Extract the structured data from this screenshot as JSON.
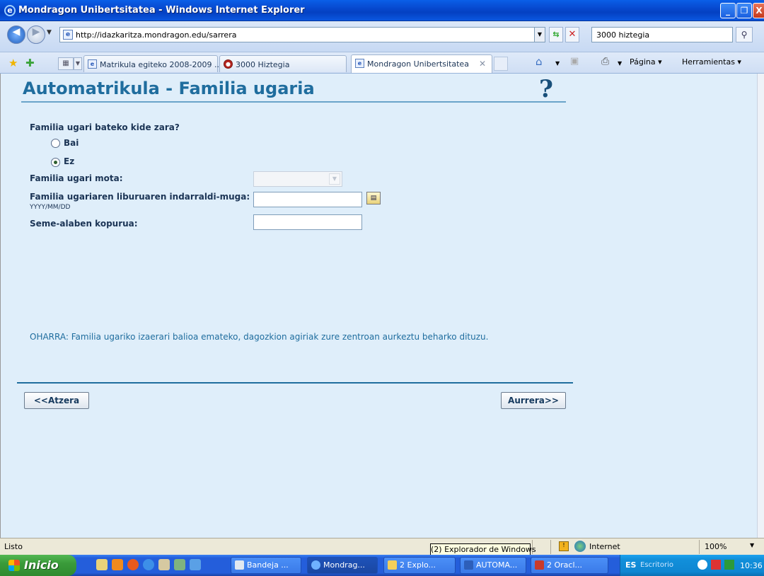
{
  "window": {
    "title": "Mondragon Unibertsitatea - Windows Internet Explorer",
    "minimize": "_",
    "maximize": "❐",
    "close": "X"
  },
  "address_bar": {
    "url": "http://idazkaritza.mondragon.edu/sarrera",
    "search_value": "3000 hiztegia"
  },
  "tabs": [
    {
      "label": "Matrikula egiteko 2008-2009 ...",
      "icon": "ie-page-icon"
    },
    {
      "label": "3000 Hiztegia",
      "icon": "hiztegia-icon"
    },
    {
      "label": "Mondragon Unibertsitatea",
      "icon": "ie-page-icon",
      "active": true
    }
  ],
  "command_bar": {
    "page_label": "Página ▾",
    "tools_label": "Herramientas ▾"
  },
  "form": {
    "title": "Automatrikula - Familia ugaria",
    "help": "?",
    "question": "Familia ugari bateko kide zara?",
    "option_yes": "Bai",
    "option_no": "Ez",
    "selected_option": "Ez",
    "type_label": "Familia ugari mota:",
    "type_value": "",
    "expiry_label": "Familia ugariaren liburuaren indarraldi-muga:",
    "date_hint": "YYYY/MM/DD",
    "expiry_value": "",
    "children_label": "Seme-alaben kopurua:",
    "children_value": "",
    "note": "OHARRA: Familia ugariko izaerari balioa emateko, dagozkion agiriak zure zentroan aurkeztu beharko dituzu.",
    "back_button": "<<Atzera",
    "next_button": "Aurrera>>"
  },
  "status_bar": {
    "text": "Listo",
    "tooltip": "(2) Explorador de Windows",
    "zone": "Internet",
    "zoom": "100%"
  },
  "taskbar": {
    "start": "Inicio",
    "tasks": [
      "Bandeja ...",
      "Mondrag...",
      "2 Explo...",
      "AUTOMA...",
      "2 Oracl..."
    ],
    "language": "ES",
    "desktop": "Escritorio",
    "clock": "10:36"
  }
}
